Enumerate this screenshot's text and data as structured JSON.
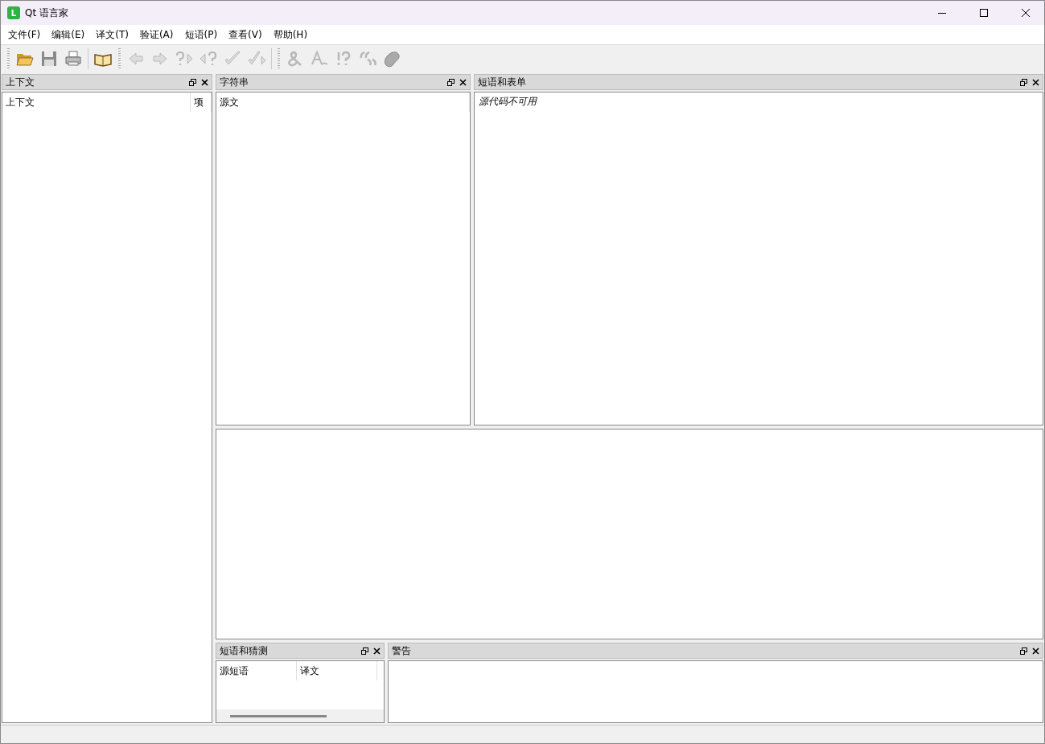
{
  "window": {
    "title": "Qt 语言家",
    "app_icon_letter": "L"
  },
  "menu": [
    "文件(F)",
    "编辑(E)",
    "译文(T)",
    "验证(A)",
    "短语(P)",
    "查看(V)",
    "帮助(H)"
  ],
  "toolbar": [
    [
      {
        "kind": "open",
        "disabled": false
      },
      {
        "kind": "save",
        "disabled": false
      },
      {
        "kind": "print",
        "disabled": false
      }
    ],
    [
      {
        "kind": "book",
        "disabled": false
      }
    ],
    [
      {
        "kind": "prev",
        "disabled": true
      },
      {
        "kind": "next",
        "disabled": true
      },
      {
        "kind": "prev-unfinished",
        "disabled": true
      },
      {
        "kind": "next-unfinished",
        "disabled": true
      },
      {
        "kind": "done",
        "disabled": true
      },
      {
        "kind": "done-next",
        "disabled": true
      }
    ],
    [
      {
        "kind": "ampersand",
        "disabled": true
      },
      {
        "kind": "letter",
        "disabled": true
      },
      {
        "kind": "punctuation",
        "disabled": true
      },
      {
        "kind": "quotes",
        "disabled": true
      },
      {
        "kind": "blob",
        "disabled": true
      }
    ]
  ],
  "context_dock": {
    "title": "上下文",
    "columns": [
      "上下文",
      "项"
    ]
  },
  "strings_dock": {
    "title": "字符串",
    "columns": [
      "源文"
    ]
  },
  "phrases_dock": {
    "title": "短语和表单",
    "message": "源代码不可用"
  },
  "guesses_dock": {
    "title": "短语和猜测",
    "columns": [
      "源短语",
      "译文"
    ]
  },
  "warnings_dock": {
    "title": "警告"
  }
}
